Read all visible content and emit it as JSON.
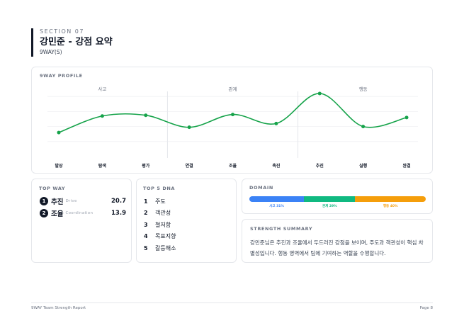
{
  "header": {
    "section": "SECTION 07",
    "title": "강민준 - 강점 요약",
    "subtitle": "9WAY(S)"
  },
  "profile": {
    "label": "9WAY PROFILE",
    "groups": [
      "사고",
      "관계",
      "행동"
    ],
    "line_color": "#16a34a",
    "chart_data": {
      "type": "line",
      "categories": [
        "발상",
        "탐색",
        "평가",
        "연결",
        "조율",
        "촉진",
        "추진",
        "실행",
        "완결"
      ],
      "values": [
        3.2,
        5.4,
        5.5,
        3.9,
        5.6,
        4.4,
        8.4,
        4.0,
        5.2
      ],
      "ylim": [
        0,
        10
      ],
      "grid": true
    }
  },
  "top_way": {
    "label": "TOP WAY",
    "items": [
      {
        "rank": "1",
        "name": "추진",
        "en": "Drive",
        "score": "20.7"
      },
      {
        "rank": "2",
        "name": "조율",
        "en": "Coordination",
        "score": "13.9"
      }
    ]
  },
  "top5": {
    "label": "TOP 5 DNA",
    "items": [
      {
        "rank": "1",
        "name": "주도"
      },
      {
        "rank": "2",
        "name": "객관성"
      },
      {
        "rank": "3",
        "name": "철저함"
      },
      {
        "rank": "4",
        "name": "목표지향"
      },
      {
        "rank": "5",
        "name": "갈등해소"
      }
    ]
  },
  "domain": {
    "label": "DOMAIN",
    "segments": [
      {
        "label": "사고 31%",
        "value": 31,
        "color": "#3b82f6"
      },
      {
        "label": "관계 29%",
        "value": 29,
        "color": "#10b981"
      },
      {
        "label": "행동 40%",
        "value": 40,
        "color": "#f59e0b"
      }
    ]
  },
  "summary": {
    "label": "STRENGTH SUMMARY",
    "text": "강민준님은 추진과 조율에서 두드러진 강점을 보이며, 주도과 객관성이 핵심 차별성입니다. 행동 영역에서 팀에 기여하는 역할을 수행합니다."
  },
  "footer": {
    "left": "9WAY Team Strength Report",
    "right": "Page 8"
  }
}
